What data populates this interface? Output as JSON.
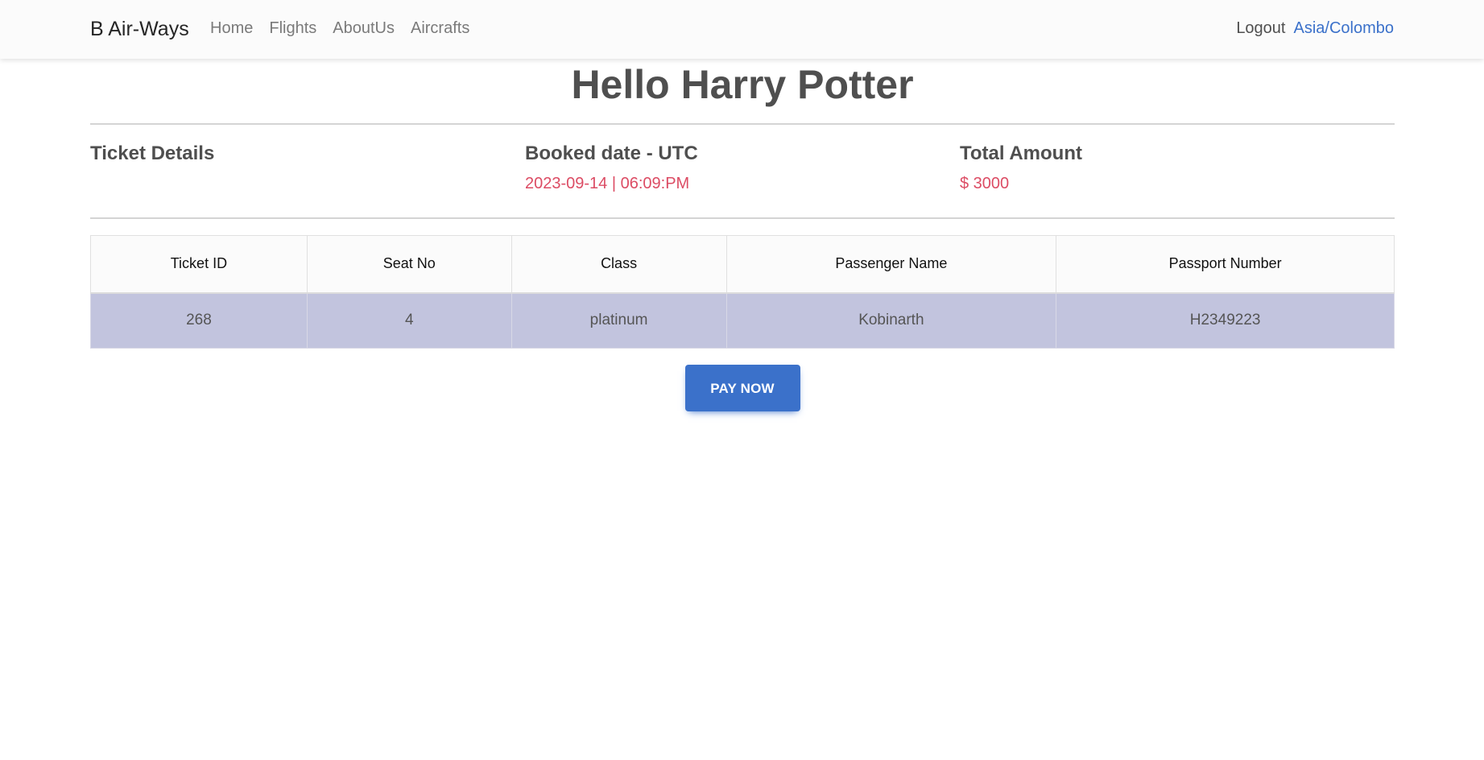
{
  "navbar": {
    "brand": "B Air-Ways",
    "links": [
      "Home",
      "Flights",
      "AboutUs",
      "Aircrafts"
    ],
    "logout": "Logout",
    "timezone": "Asia/Colombo"
  },
  "greeting": "Hello Harry Potter",
  "summary": {
    "ticket_details_label": "Ticket Details",
    "booked_date_label": "Booked date - UTC",
    "booked_date_value": "2023-09-14 | 06:09:PM",
    "total_amount_label": "Total Amount",
    "total_amount_value": "$ 3000"
  },
  "table": {
    "headers": [
      "Ticket ID",
      "Seat No",
      "Class",
      "Passenger Name",
      "Passport Number"
    ],
    "rows": [
      [
        "268",
        "4",
        "platinum",
        "Kobinarth",
        "H2349223"
      ]
    ]
  },
  "actions": {
    "pay_now": "PAY NOW"
  },
  "colors": {
    "accent": "#3b71ca",
    "danger": "#dc4c64",
    "row_highlight": "#c2c4de"
  }
}
